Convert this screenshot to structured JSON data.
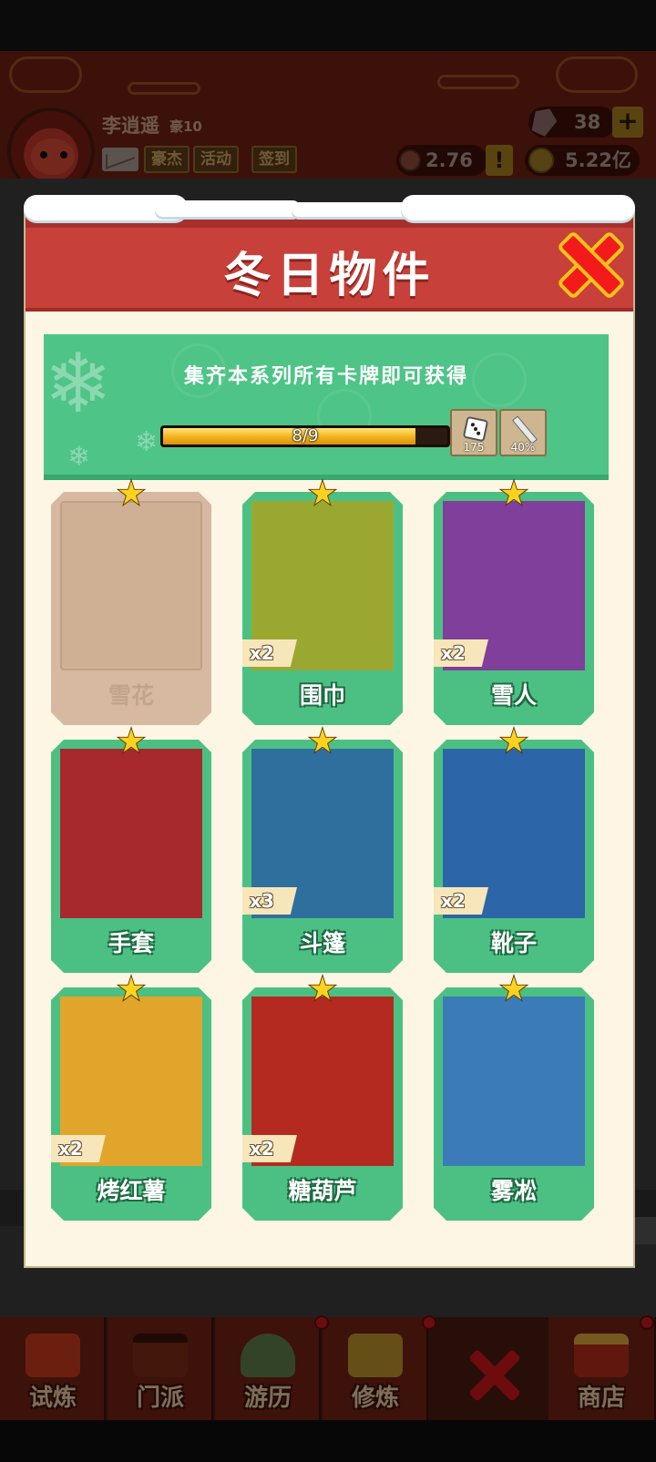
{
  "player": {
    "name": "李逍遥",
    "level": "豪10",
    "gems": "38",
    "silver": "2.76万",
    "gold": "5.22亿"
  },
  "top_buttons": [
    "豪杰",
    "活动",
    "签到"
  ],
  "modal": {
    "title": "冬日物件",
    "banner_text": "集齐本系列所有卡牌即可获得",
    "progress": {
      "label": "8/9",
      "fraction": 0.889
    },
    "rewards": [
      {
        "icon": "dice-icon",
        "value": "175"
      },
      {
        "icon": "sword-icon",
        "value": "40%"
      }
    ]
  },
  "cards": [
    {
      "name": "雪花",
      "count": "",
      "locked": true,
      "bg": "#cfb095"
    },
    {
      "name": "围巾",
      "count": "x2",
      "locked": false,
      "bg": "#9aa832"
    },
    {
      "name": "雪人",
      "count": "x2",
      "locked": false,
      "bg": "#7f3f9a"
    },
    {
      "name": "手套",
      "count": "",
      "locked": false,
      "bg": "#a7292d"
    },
    {
      "name": "斗篷",
      "count": "x3",
      "locked": false,
      "bg": "#2f6f9e"
    },
    {
      "name": "靴子",
      "count": "x2",
      "locked": false,
      "bg": "#2c66a8"
    },
    {
      "name": "烤红薯",
      "count": "x2",
      "locked": false,
      "bg": "#e0a52a"
    },
    {
      "name": "糖葫芦",
      "count": "x2",
      "locked": false,
      "bg": "#b42a20"
    },
    {
      "name": "雾凇",
      "count": "",
      "locked": false,
      "bg": "#3a7bb8"
    }
  ],
  "bottom_nav": [
    "试炼",
    "门派",
    "游历",
    "修炼",
    "商店"
  ]
}
